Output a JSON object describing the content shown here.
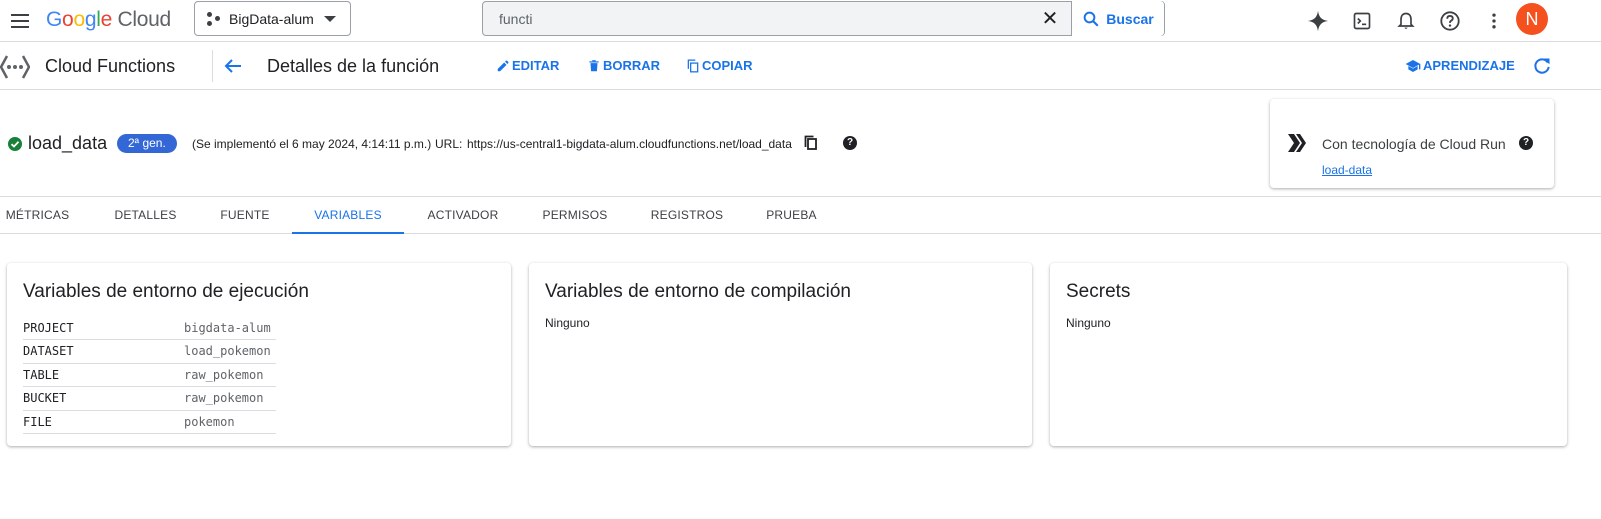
{
  "topbar": {
    "logo": {
      "g": "G",
      "o1": "o",
      "o2": "o",
      "g2": "g",
      "l": "l",
      "e": "e",
      "cloud": "Cloud"
    },
    "project": "BigData-alum",
    "search": {
      "value": "functi",
      "button": "Buscar"
    },
    "icons": [
      "gemini-icon",
      "cloud-shell-icon",
      "notifications-icon",
      "help-icon",
      "more-vert-icon"
    ],
    "avatar_letter": "N"
  },
  "subbar": {
    "product": "Cloud Functions",
    "title": "Detalles de la función",
    "actions": {
      "edit": "EDITAR",
      "delete": "BORRAR",
      "copy": "COPIAR",
      "learn": "APRENDIZAJE"
    }
  },
  "function": {
    "name": "load_data",
    "generation": "2ª gen.",
    "deployed": "(Se implementó el 6 may 2024, 4:14:11 p.m.)",
    "url_label": "URL:",
    "url": "https://us-central1-bigdata-alum.cloudfunctions.net/load_data"
  },
  "cloud_run": {
    "title": "Con tecnología de Cloud Run",
    "service": "load-data"
  },
  "tabs": [
    "MÉTRICAS",
    "DETALLES",
    "FUENTE",
    "VARIABLES",
    "ACTIVADOR",
    "PERMISOS",
    "REGISTROS",
    "PRUEBA"
  ],
  "active_tab": "VARIABLES",
  "runtime_env": {
    "title": "Variables de entorno de ejecución",
    "vars": [
      {
        "key": "PROJECT",
        "value": "bigdata-alum"
      },
      {
        "key": "DATASET",
        "value": "load_pokemon"
      },
      {
        "key": "TABLE",
        "value": "raw_pokemon"
      },
      {
        "key": "BUCKET",
        "value": "raw_pokemon"
      },
      {
        "key": "FILE",
        "value": "pokemon"
      }
    ]
  },
  "build_env": {
    "title": "Variables de entorno de compilación",
    "empty": "Ninguno"
  },
  "secrets": {
    "title": "Secrets",
    "empty": "Ninguno"
  },
  "colors": {
    "accent": "#1a73e8",
    "chip": "#3367d6",
    "status_ok": "#188038",
    "avatar": "#f4511e"
  }
}
